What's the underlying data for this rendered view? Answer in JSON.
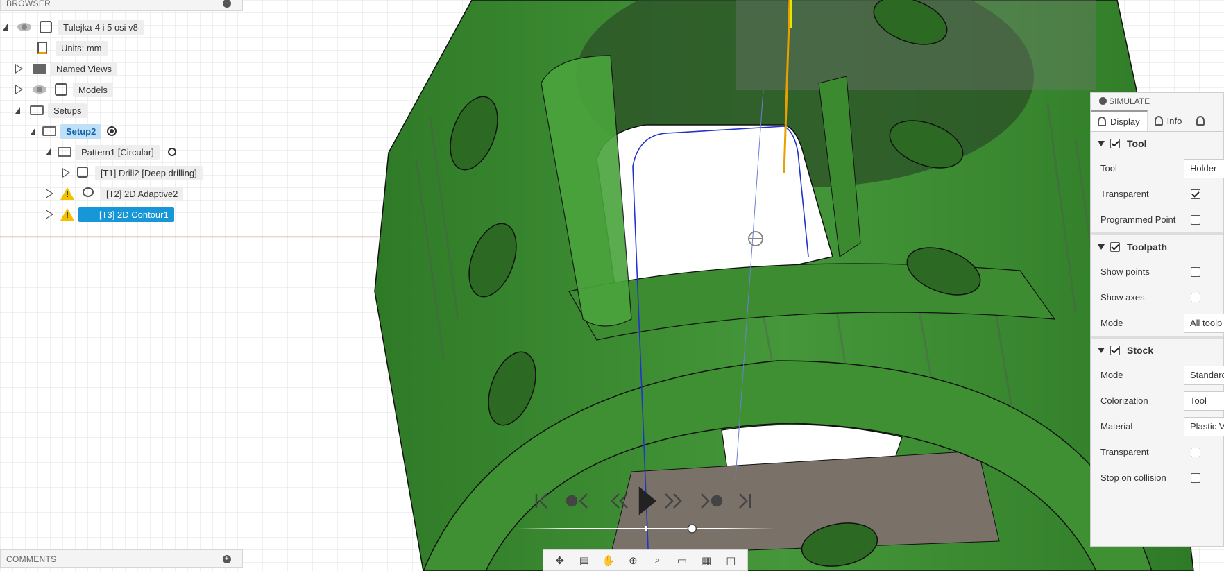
{
  "browser": {
    "title": "BROWSER",
    "root": "Tulejka-4 i 5 osi v8",
    "units": "Units: mm",
    "named_views": "Named Views",
    "models": "Models",
    "setups": "Setups",
    "setup2": "Setup2",
    "pattern1": "Pattern1 [Circular]",
    "op_t1": "[T1] Drill2 [Deep drilling]",
    "op_t2": "[T2] 2D Adaptive2",
    "op_t3": "[T3] 2D Contour1"
  },
  "comments": {
    "title": "COMMENTS"
  },
  "simulate": {
    "title": "SIMULATE",
    "tabs": [
      "Display",
      "Info",
      ""
    ],
    "tool": {
      "header": "Tool",
      "tool_label": "Tool",
      "tool_value": "Holder",
      "transparent_label": "Transparent",
      "programmed_point_label": "Programmed Point"
    },
    "toolpath": {
      "header": "Toolpath",
      "show_points_label": "Show points",
      "show_axes_label": "Show axes",
      "mode_label": "Mode",
      "mode_value": "All toolp"
    },
    "stock": {
      "header": "Stock",
      "mode_label": "Mode",
      "mode_value": "Standard",
      "colorization_label": "Colorization",
      "colorization_value": "Tool",
      "material_label": "Material",
      "material_value": "Plastic V",
      "transparent_label": "Transparent",
      "stop_on_collision_label": "Stop on collision"
    }
  },
  "colors": {
    "model_green": "#3a8a2f",
    "model_dark": "#2a6322",
    "highlight_blue": "#1796d8",
    "toolpath_blue": "#2233cc",
    "tool_orange": "#e8a000"
  },
  "playback": {
    "progress": 0.7
  }
}
